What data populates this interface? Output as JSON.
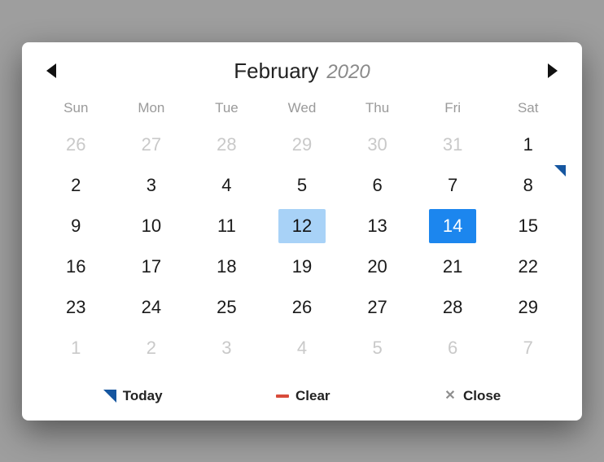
{
  "header": {
    "month": "February",
    "year": "2020"
  },
  "weekdays": [
    "Sun",
    "Mon",
    "Tue",
    "Wed",
    "Thu",
    "Fri",
    "Sat"
  ],
  "days": [
    {
      "n": "26",
      "outside": true
    },
    {
      "n": "27",
      "outside": true
    },
    {
      "n": "28",
      "outside": true
    },
    {
      "n": "29",
      "outside": true
    },
    {
      "n": "30",
      "outside": true
    },
    {
      "n": "31",
      "outside": true
    },
    {
      "n": "1"
    },
    {
      "n": "2"
    },
    {
      "n": "3"
    },
    {
      "n": "4"
    },
    {
      "n": "5"
    },
    {
      "n": "6"
    },
    {
      "n": "7"
    },
    {
      "n": "8",
      "today": true
    },
    {
      "n": "9"
    },
    {
      "n": "10"
    },
    {
      "n": "11"
    },
    {
      "n": "12",
      "highlight": true
    },
    {
      "n": "13"
    },
    {
      "n": "14",
      "selected": true
    },
    {
      "n": "15"
    },
    {
      "n": "16"
    },
    {
      "n": "17"
    },
    {
      "n": "18"
    },
    {
      "n": "19"
    },
    {
      "n": "20"
    },
    {
      "n": "21"
    },
    {
      "n": "22"
    },
    {
      "n": "23"
    },
    {
      "n": "24"
    },
    {
      "n": "25"
    },
    {
      "n": "26"
    },
    {
      "n": "27"
    },
    {
      "n": "28"
    },
    {
      "n": "29"
    },
    {
      "n": "1",
      "outside": true
    },
    {
      "n": "2",
      "outside": true
    },
    {
      "n": "3",
      "outside": true
    },
    {
      "n": "4",
      "outside": true
    },
    {
      "n": "5",
      "outside": true
    },
    {
      "n": "6",
      "outside": true
    },
    {
      "n": "7",
      "outside": true
    }
  ],
  "footer": {
    "today": "Today",
    "clear": "Clear",
    "close": "Close"
  }
}
